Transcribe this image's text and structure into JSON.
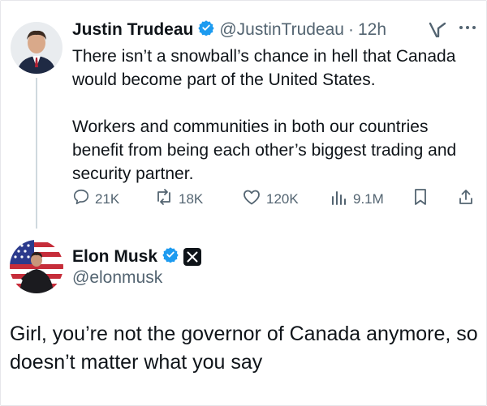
{
  "tweet1": {
    "author_name": "Justin Trudeau",
    "handle": "@JustinTrudeau",
    "separator": "·",
    "time": "12h",
    "paragraph1": "There isn’t a snowball’s chance in hell that Canada would become part of the United States.",
    "paragraph2": "Workers and communities in both our countries benefit from being each other’s biggest trading and security partner.",
    "stats": {
      "replies": "21K",
      "reposts": "18K",
      "likes": "120K",
      "views": "9.1M"
    }
  },
  "tweet2": {
    "author_name": "Elon Musk",
    "handle": "@elonmusk",
    "text": "Girl, you’re not the governor of Canada anymore, so doesn’t matter what you say"
  },
  "colors": {
    "verified_blue": "#1d9bf0",
    "secondary_text": "#536471",
    "primary_text": "#0f1419",
    "thread_line": "#cfd9de"
  },
  "icons": [
    "verified-badge-icon",
    "grok-icon",
    "more-icon",
    "reply-icon",
    "repost-icon",
    "like-icon",
    "views-icon",
    "bookmark-icon",
    "share-icon",
    "x-logo-icon"
  ]
}
